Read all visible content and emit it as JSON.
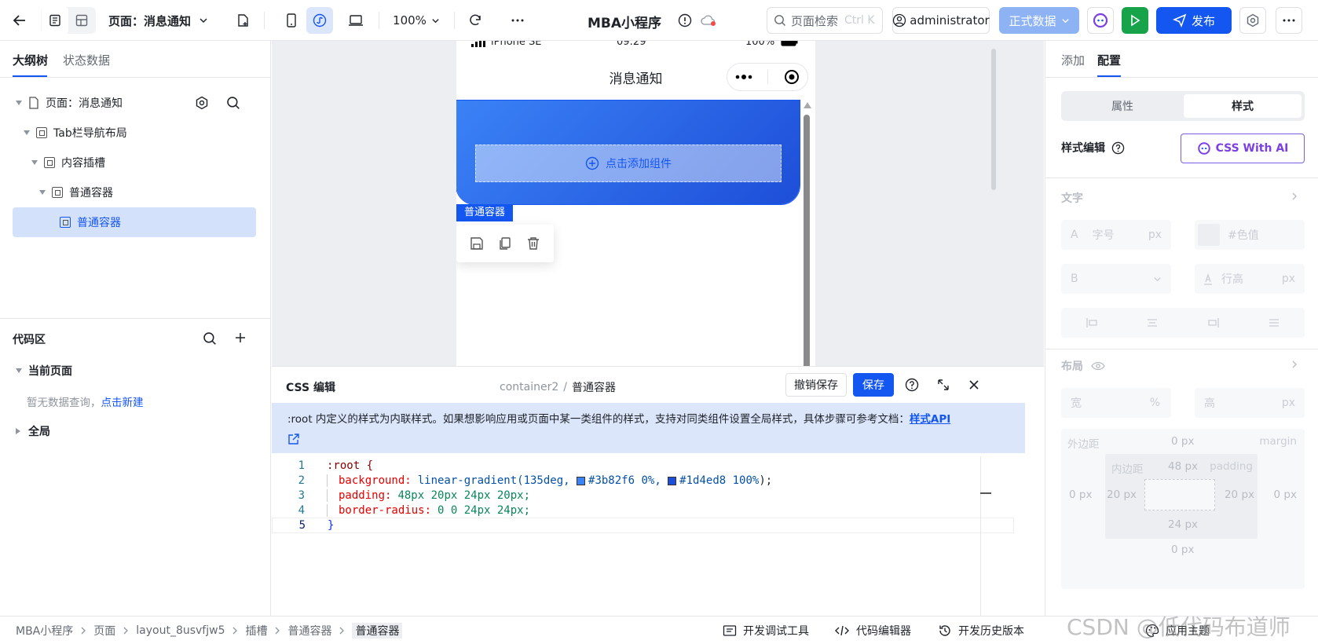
{
  "topbar": {
    "page_selector": "页面：消息通知",
    "zoom": "100%",
    "app_title": "MBA小程序",
    "search_placeholder": "页面检索",
    "search_shortcut": "Ctrl K",
    "user": "administrator",
    "env_label": "正式数据",
    "publish_label": "发布"
  },
  "left": {
    "tabs": [
      "大纲树",
      "状态数据"
    ],
    "tree": [
      {
        "label": "页面：消息通知",
        "level": 0
      },
      {
        "label": "Tab栏导航布局",
        "level": 1
      },
      {
        "label": "内容插槽",
        "level": 2
      },
      {
        "label": "普通容器",
        "level": 3
      },
      {
        "label": "普通容器",
        "level": 4
      }
    ],
    "code_title": "代码区",
    "current_page": "当前页面",
    "no_query": "暂无数据查询，",
    "new_link": "点击新建",
    "global": "全局"
  },
  "phone": {
    "status_carrier": "iPhone SE",
    "status_time": "09:29",
    "status_battery": "100%",
    "nav_title": "消息通知",
    "add_component": "点击添加组件",
    "selected_tag": "普通容器"
  },
  "css_panel": {
    "title": "CSS 编辑",
    "path_id": "container2",
    "path_sep": "/",
    "path_name": "普通容器",
    "undo_label": "撤销保存",
    "save_label": "保存",
    "info": ":root 内定义的样式为内联样式。如果想影响应用或页面中某一类组件的样式，支持对同类组件设置全局样式，具体步骤可参考文档：",
    "info_link": "样式API",
    "code": [
      {
        "n": "1",
        "text": ":root {"
      },
      {
        "n": "2",
        "prop": "background:",
        "fn": "linear-gradient(135deg, ",
        "c1": "#3b82f6 0%",
        "c2": "#1d4ed8 100%",
        "end": ");"
      },
      {
        "n": "3",
        "prop": "padding:",
        "val": "48px 20px 24px 20px;"
      },
      {
        "n": "4",
        "prop": "border-radius:",
        "val": "0 0 24px 24px;"
      },
      {
        "n": "5",
        "text": "}"
      }
    ],
    "colors": {
      "c1": "#3b82f6",
      "c2": "#1d4ed8"
    }
  },
  "right": {
    "tabs": [
      "添加",
      "配置"
    ],
    "seg": [
      "属性",
      "样式"
    ],
    "style_edit": "样式编辑",
    "ai_btn": "CSS With AI",
    "text_section": "文字",
    "font_size_prefix": "A",
    "font_size_ph": "字号",
    "font_size_unit": "px",
    "color_ph": "#色值",
    "bold_prefix": "B",
    "line_height_ph": "行高",
    "line_height_unit": "px",
    "layout_section": "布局",
    "width_label": "宽",
    "width_unit": "%",
    "height_label": "高",
    "height_unit": "px",
    "margin_label": "外边距",
    "margin_en": "margin",
    "padding_label": "内边距",
    "padding_en": "padding",
    "margin_top": "0 px",
    "margin_left": "0 px",
    "margin_right": "0 px",
    "margin_bottom": "0 px",
    "padding_top": "48 px",
    "padding_left": "20 px",
    "padding_right": "20 px",
    "padding_bottom": "24 px"
  },
  "bottom": {
    "crumbs": [
      "MBA小程序",
      "页面",
      "layout_8usvfjw5",
      "插槽",
      "普通容器",
      "普通容器"
    ],
    "tools": [
      "开发调试工具",
      "代码编辑器",
      "开发历史版本",
      "应用主题"
    ],
    "watermark": "CSDN @低代码布道师"
  }
}
